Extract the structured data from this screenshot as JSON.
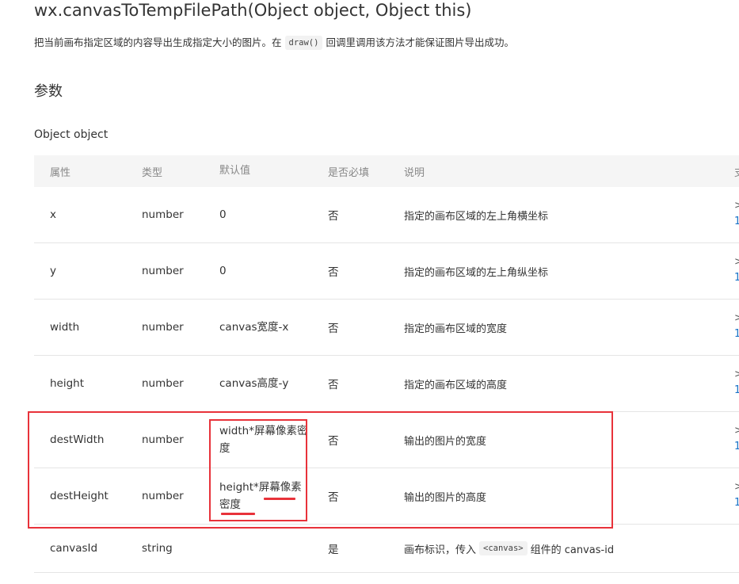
{
  "page": {
    "title": "wx.canvasToTempFilePath(Object object, Object this)",
    "description_before": "把当前画布指定区域的内容导出生成指定大小的图片。在",
    "description_code": "draw()",
    "description_after": "回调里调用该方法才能保证图片导出成功。",
    "section_heading": "参数",
    "object_label": "Object object"
  },
  "table": {
    "headers": [
      "属性",
      "类型",
      "默认值",
      "是否必填",
      "说明",
      "支"
    ],
    "rows": [
      {
        "name": "x",
        "type": "number",
        "default": "0",
        "required": "否",
        "description": "指定的画布区域的左上角横坐标",
        "version_a": ">",
        "version_b": "1"
      },
      {
        "name": "y",
        "type": "number",
        "default": "0",
        "required": "否",
        "description": "指定的画布区域的左上角纵坐标",
        "version_a": ">",
        "version_b": "1"
      },
      {
        "name": "width",
        "type": "number",
        "default": "canvas宽度-x",
        "required": "否",
        "description": "指定的画布区域的宽度",
        "version_a": ">",
        "version_b": "1"
      },
      {
        "name": "height",
        "type": "number",
        "default": "canvas高度-y",
        "required": "否",
        "description": "指定的画布区域的高度",
        "version_a": ">",
        "version_b": "1"
      },
      {
        "name": "destWidth",
        "type": "number",
        "default": "width*屏幕像素密度",
        "required": "否",
        "description": "输出的图片的宽度",
        "version_a": ">",
        "version_b": "1"
      },
      {
        "name": "destHeight",
        "type": "number",
        "default": "height*屏幕像素密度",
        "required": "否",
        "description": "输出的图片的高度",
        "version_a": ">",
        "version_b": "1"
      },
      {
        "name": "canvasId",
        "type": "string",
        "default": "",
        "required": "是",
        "description_before": "画布标识，传入",
        "description_code": "<canvas>",
        "description_after": "组件的 canvas-id"
      }
    ]
  },
  "annotations": {
    "color": "#e8323a"
  }
}
